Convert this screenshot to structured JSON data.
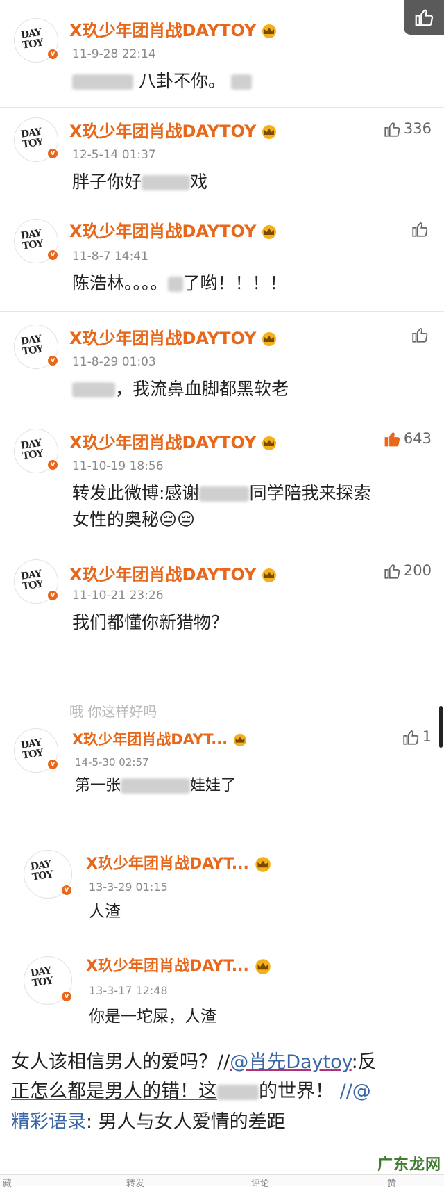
{
  "comments": [
    {
      "name": "X玖少年团肖战DAYTOY",
      "time": "11-9-28 22:14",
      "text_a": "",
      "text_b": "八卦不你。",
      "likes": ""
    },
    {
      "name": "X玖少年团肖战DAYTOY",
      "time": "12-5-14 01:37",
      "text_a": "胖子你好",
      "text_b": "戏",
      "likes": "336"
    },
    {
      "name": "X玖少年团肖战DAYTOY",
      "time": "11-8-7 14:41",
      "text_a": "陈浩林。。。。",
      "text_b": "了哟！！！！",
      "likes": ""
    },
    {
      "name": "X玖少年团肖战DAYTOY",
      "time": "11-8-29 01:03",
      "text_a": "",
      "text_b": "，我流鼻血脚都黑软老",
      "likes": ""
    },
    {
      "name": "X玖少年团肖战DAYTOY",
      "time": "11-10-19 18:56",
      "text_a": "转发此微博:感谢",
      "text_b": "同学陪我来探索",
      "text_c": "女性的奥秘😔😔",
      "likes": "643"
    },
    {
      "name": "X玖少年团肖战DAYTOY",
      "time": "11-10-21 23:26",
      "text_a": "我们都懂你新猎物？",
      "text_b": "",
      "likes": "200"
    },
    {
      "name": "X玖少年团肖战DAYT...",
      "time": "14-5-30 02:57",
      "text_a": "第一张",
      "text_b": "娃娃了",
      "likes": "1"
    },
    {
      "name": "X玖少年团肖战DAYT...",
      "time": "13-3-29 01:15",
      "text_a": "人渣",
      "text_b": "",
      "likes": ""
    },
    {
      "name": "X玖少年团肖战DAYT...",
      "time": "13-3-17 12:48",
      "text_a": "你是一坨屎，人渣",
      "text_b": "",
      "likes": ""
    }
  ],
  "avatar": {
    "line1": "DAY",
    "line2": "TOY",
    "badge": "v"
  },
  "ghost_text": "哦 你这样好吗",
  "post": {
    "line1_text": "女人该相信男人的爱吗？//",
    "line1_link": "@肖先Daytoy",
    "line1_tail": ":反",
    "line2_text": "正怎么都是男人的错！这",
    "line2_tail": "的世界！",
    "line2_link": "//@",
    "line3_link": "精彩语录",
    "line3_text": ": 男人与女人爱情的差距"
  },
  "bottom_bar": {
    "a": "藏",
    "b": "转发",
    "c": "评论",
    "d": "赞"
  },
  "watermark": "广东龙网",
  "colors": {
    "name": "#e8681b",
    "like_active": "#e8681b",
    "link": "#3b66a6"
  }
}
